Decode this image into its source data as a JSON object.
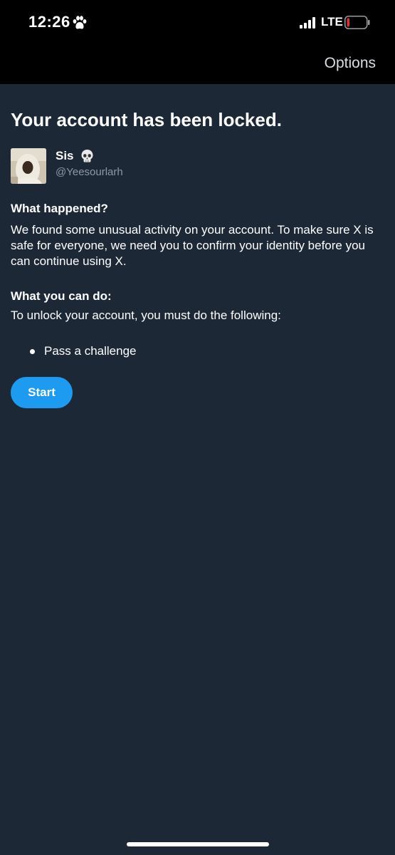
{
  "status_bar": {
    "time": "12:26",
    "network": "LTE",
    "icons": [
      "paw-icon",
      "cellular-signal-icon",
      "battery-low-icon"
    ],
    "battery_color": "#e0312f"
  },
  "header": {
    "options_label": "Options"
  },
  "page": {
    "title": "Your account has been locked.",
    "user": {
      "display_name": "Sis",
      "emoji": "skull-icon",
      "handle": "@Yeesourlarh"
    },
    "what_happened": {
      "heading": "What happened?",
      "body": "We found some unusual activity on your account. To make sure X is safe for everyone, we need you to confirm your identity before you can continue using X."
    },
    "what_you_can_do": {
      "heading": "What you can do:",
      "body": "To unlock your account, you must do the following:",
      "steps": [
        "Pass a challenge"
      ]
    },
    "start_label": "Start"
  },
  "colors": {
    "background": "#1d2836",
    "topbar": "#000000",
    "accent": "#1d9bf0",
    "muted_text": "#8b98a5"
  }
}
